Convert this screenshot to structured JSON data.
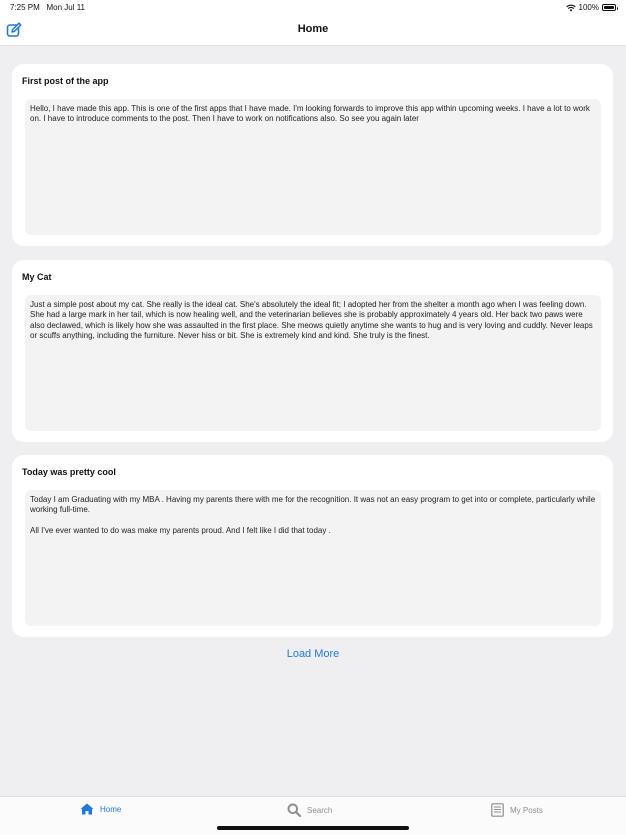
{
  "status_bar": {
    "time": "7:25 PM",
    "date": "Mon Jul 11",
    "battery": "100%"
  },
  "nav": {
    "title": "Home",
    "compose_icon": "compose-icon"
  },
  "posts": [
    {
      "title": "First post of the app",
      "body": [
        "Hello, I have made this app. This is one of the first apps that I have made. I'm looking forwards to improve this app within upcoming weeks. I have a lot to work on. I have to introduce comments to the post. Then I have to work on notifications also. So see you again later"
      ]
    },
    {
      "title": "My Cat",
      "body": [
        "Just a simple post about my cat. She really is the ideal cat. She's absolutely the ideal fit; I adopted her from the shelter a month ago when I was feeling down. She had a large mark in her tail, which is now healing well, and the veterinarian believes she is probably approximately 4 years old. Her back two paws were also declawed, which is likely how she was assaulted in the first place. She meows quietly anytime she wants to hug and is very loving and cuddly. Never leaps or scuffs anything, including the furniture. Never hiss or bit. She is extremely kind and kind. She truly is the finest."
      ]
    },
    {
      "title": "Today was pretty cool",
      "body": [
        "Today I am Graduating with my MBA . Having my parents there with me for the recognition. It was not an easy program to get into or complete, particularly while working full-time.",
        "All I've ever wanted to do was make my parents proud. And I felt like I did that today ."
      ]
    }
  ],
  "load_more_label": "Load More",
  "tabs": [
    {
      "label": "Home",
      "icon": "house-icon",
      "active": true
    },
    {
      "label": "Search",
      "icon": "magnifier-icon",
      "active": false
    },
    {
      "label": "My Posts",
      "icon": "document-list-icon",
      "active": false
    }
  ],
  "colors": {
    "accent": "#1e7ad8",
    "background": "#efeff1",
    "card": "#ffffff",
    "body_field": "#f3f3f4",
    "inactive": "#8e8e93"
  }
}
